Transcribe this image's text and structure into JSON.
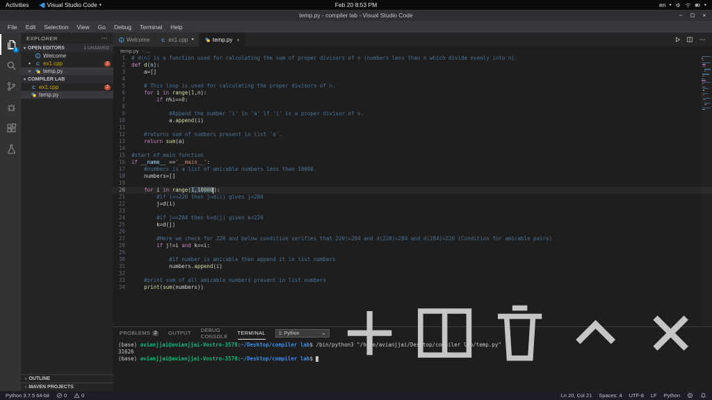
{
  "colors": {
    "accent": "#007acc",
    "problem_badge": "#bb4b32",
    "terminal_user": "#0dbc79",
    "terminal_path": "#3b8eea",
    "comment": "#4a7396",
    "keyword": "#c586c0",
    "string": "#ce9178",
    "number": "#b5cea8",
    "function": "#dcdcaa",
    "variable": "#9cdcfe"
  },
  "desktop_bar": {
    "activities_label": "Activities",
    "app_menu_label": "Visual Studio Code",
    "clock": "Feb 20  8:53 PM",
    "input_language": "en",
    "tray_icons": [
      "volume",
      "network",
      "battery"
    ]
  },
  "window": {
    "title": "temp.py - compiler lab - Visual Studio Code"
  },
  "menu_bar": {
    "items": [
      "File",
      "Edit",
      "Selection",
      "View",
      "Go",
      "Debug",
      "Terminal",
      "Help"
    ]
  },
  "activity_bar": {
    "items": [
      {
        "name": "explorer",
        "icon": "files",
        "active": true,
        "badge": "1"
      },
      {
        "name": "search",
        "icon": "search"
      },
      {
        "name": "source-control",
        "icon": "source-control"
      },
      {
        "name": "debug",
        "icon": "debug"
      },
      {
        "name": "extensions",
        "icon": "extensions"
      },
      {
        "name": "test",
        "icon": "beaker"
      }
    ]
  },
  "sidebar": {
    "title": "EXPLORER",
    "open_editors": {
      "label": "OPEN EDITORS",
      "hint": "1 UNSAVED",
      "items": [
        {
          "label": "Welcome",
          "icon": "welcome-file"
        },
        {
          "label": "ex1.cpp",
          "icon": "cpp-file",
          "badge": "2",
          "modified": true,
          "label_color": "#cca700"
        },
        {
          "label": "temp.py",
          "icon": "py-file",
          "selected": true,
          "close": true
        }
      ]
    },
    "folder": {
      "label": "COMPILER LAB",
      "items": [
        {
          "label": "ex1.cpp",
          "icon": "cpp-file",
          "badge": "2",
          "label_color": "#cca700"
        },
        {
          "label": "temp.py",
          "icon": "py-file",
          "selected": true
        }
      ]
    },
    "bottom_sections": [
      "OUTLINE",
      "MAVEN PROJECTS"
    ]
  },
  "editor": {
    "tabs": [
      {
        "label": "Welcome",
        "icon": "welcome-file"
      },
      {
        "label": "ex1.cpp",
        "icon": "cpp-file",
        "modified": true
      },
      {
        "label": "temp.py",
        "icon": "py-file",
        "active": true,
        "close": true
      }
    ],
    "tab_actions": [
      "run",
      "split-editor",
      "more"
    ],
    "breadcrumb": [
      "temp.py",
      "..."
    ],
    "cursor_line": 20,
    "lines": [
      [
        [
          "c",
          "# d(n) is a function used for calculating the sum of proper divisors of n (numbers less than n which divide evenly into n)."
        ]
      ],
      [
        [
          "k",
          "def "
        ],
        [
          "f",
          "d"
        ],
        [
          "t",
          "("
        ],
        [
          "v",
          "n"
        ],
        [
          "t",
          "):"
        ]
      ],
      [
        [
          "t",
          "    a=[]"
        ]
      ],
      [],
      [
        [
          "c",
          "    # This loop is used for calculating the proper divisors of n."
        ]
      ],
      [
        [
          "t",
          "    "
        ],
        [
          "k",
          "for "
        ],
        [
          "t",
          "i "
        ],
        [
          "k",
          "in "
        ],
        [
          "f",
          "range"
        ],
        [
          "t",
          "("
        ],
        [
          "n",
          "1"
        ],
        [
          "t",
          ",n):"
        ]
      ],
      [
        [
          "t",
          "        "
        ],
        [
          "k",
          "if "
        ],
        [
          "t",
          "n%i=="
        ],
        [
          "n",
          "0"
        ],
        [
          "t",
          ":"
        ]
      ],
      [],
      [
        [
          "c",
          "            #Append the number 'i' in 'a' if 'i' is a proper divisor of n."
        ]
      ],
      [
        [
          "t",
          "            a."
        ],
        [
          "f",
          "append"
        ],
        [
          "t",
          "(i)"
        ]
      ],
      [],
      [
        [
          "c",
          "    #returns sum of numbers present in list 'a'."
        ]
      ],
      [
        [
          "t",
          "    "
        ],
        [
          "k",
          "return "
        ],
        [
          "f",
          "sum"
        ],
        [
          "t",
          "(a)"
        ]
      ],
      [],
      [
        [
          "c",
          "#start of main function"
        ]
      ],
      [
        [
          "k",
          "if "
        ],
        [
          "v",
          "__name__"
        ],
        [
          "t",
          " =="
        ],
        [
          "s",
          "'__main__'"
        ],
        [
          "t",
          ":"
        ]
      ],
      [
        [
          "c",
          "    #numbers is a list of amicable numbers less than 10000."
        ]
      ],
      [
        [
          "t",
          "    numbers=[]"
        ]
      ],
      [],
      [
        [
          "t",
          "    "
        ],
        [
          "k",
          "for "
        ],
        [
          "t",
          "i "
        ],
        [
          "k",
          "in "
        ],
        [
          "f",
          "range"
        ],
        [
          "t",
          "("
        ],
        [
          "nh",
          "1"
        ],
        [
          "th",
          ","
        ],
        [
          "nh",
          "10000"
        ],
        [
          "cur",
          ""
        ],
        [
          "t",
          "):"
        ]
      ],
      [
        [
          "c",
          "        #if i==220 then j=d(i) gives j=284"
        ]
      ],
      [
        [
          "t",
          "        j=d(i)"
        ]
      ],
      [],
      [
        [
          "c",
          "        #if j==284 then k=d(j) gives k=220"
        ]
      ],
      [
        [
          "t",
          "        k=d(j)"
        ]
      ],
      [],
      [
        [
          "c",
          "        #Here we check for 220 and below condition verifies that 220!=284 and d(220)=284 and d(284)=220 (Condition for amicable pairs)"
        ]
      ],
      [
        [
          "t",
          "        "
        ],
        [
          "k",
          "if "
        ],
        [
          "t",
          "j!=i "
        ],
        [
          "k",
          "and "
        ],
        [
          "t",
          "k==i:"
        ]
      ],
      [],
      [
        [
          "c",
          "            #if number is amicable then append it in list numbers"
        ]
      ],
      [
        [
          "t",
          "            numbers."
        ],
        [
          "f",
          "append"
        ],
        [
          "t",
          "(i)"
        ]
      ],
      [],
      [
        [
          "c",
          "    #print sum of all amicable numbers present in list numbers"
        ]
      ],
      [
        [
          "t",
          "    "
        ],
        [
          "f",
          "print"
        ],
        [
          "t",
          "("
        ],
        [
          "f",
          "sum"
        ],
        [
          "t",
          "(numbers))"
        ]
      ]
    ]
  },
  "panel": {
    "tabs": [
      {
        "label": "PROBLEMS",
        "badge": "2"
      },
      {
        "label": "OUTPUT"
      },
      {
        "label": "DEBUG CONSOLE"
      },
      {
        "label": "TERMINAL",
        "active": true
      }
    ],
    "terminal_selector": "1: Python",
    "actions": [
      "plus",
      "split",
      "trash",
      "chevron-up",
      "close"
    ],
    "terminal_lines": [
      [
        [
          "p",
          "(base) "
        ],
        [
          "u",
          "avianjjai@avianjjai-Vostro-3578"
        ],
        [
          "p",
          ":"
        ],
        [
          "d",
          "~/Desktop/compiler lab"
        ],
        [
          "p",
          "$ /bin/python3 \"/home/avianjjai/Desktop/compiler lab/temp.py\""
        ]
      ],
      [
        [
          "p",
          "31626"
        ]
      ],
      [
        [
          "p",
          "(base) "
        ],
        [
          "u",
          "avianjjai@avianjjai-Vostro-3578"
        ],
        [
          "p",
          ":"
        ],
        [
          "d",
          "~/Desktop/compiler lab"
        ],
        [
          "p",
          "$ "
        ],
        [
          "cur",
          ""
        ]
      ]
    ]
  },
  "status_bar": {
    "left": [
      {
        "name": "python-version",
        "label": "Python 3.7.5 64-bit"
      },
      {
        "name": "errors",
        "icon": "error",
        "label": "0"
      },
      {
        "name": "warnings",
        "icon": "warning",
        "label": "0"
      }
    ],
    "right": [
      {
        "name": "cursor-position",
        "label": "Ln 20, Col 21"
      },
      {
        "name": "indentation",
        "label": "Spaces: 4"
      },
      {
        "name": "encoding",
        "label": "UTF-8"
      },
      {
        "name": "eol",
        "label": "LF"
      },
      {
        "name": "language-mode",
        "label": "Python"
      },
      {
        "name": "feedback",
        "icon": "smiley"
      },
      {
        "name": "notifications",
        "icon": "bell"
      }
    ]
  }
}
